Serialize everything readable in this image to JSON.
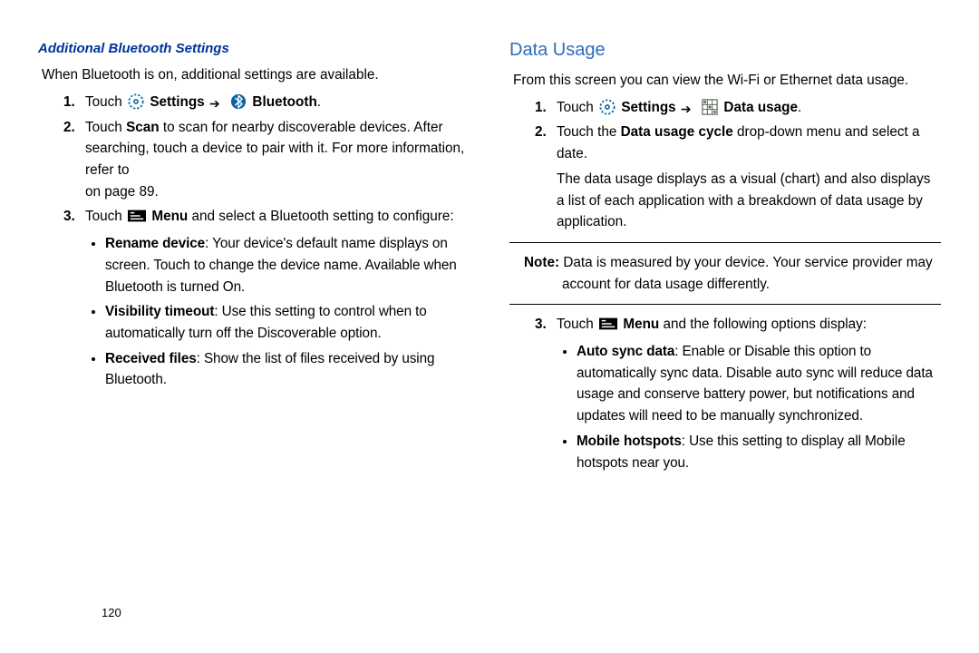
{
  "left": {
    "heading": "Additional Bluetooth Settings",
    "intro": "When Bluetooth is on, additional settings are available.",
    "step1": {
      "n": "1.",
      "pre": "Touch ",
      "settings": " Settings ",
      "bluetooth": " Bluetooth",
      "dot": "."
    },
    "step2": {
      "n": "2.",
      "l1a": "Touch ",
      "l1b": "Scan",
      "l1c": " to scan for nearby discoverable devices. After searching, touch a device to pair with it. For more information, refer to",
      "l2": "on page 89."
    },
    "step3": {
      "n": "3.",
      "pre": "Touch ",
      "menu": " Menu",
      "post": " and select a Bluetooth setting to configure:"
    },
    "bul1": {
      "h": "Rename device",
      "t": ": Your device's default name displays on screen. Touch to change the device name. Available when Bluetooth is turned On."
    },
    "bul2": {
      "h": "Visibility timeout",
      "t": ": Use this setting to control when to automatically turn off the Discoverable option."
    },
    "bul3": {
      "h": "Received files",
      "t": ": Show the list of files received by using Bluetooth."
    }
  },
  "right": {
    "heading": "Data Usage",
    "intro": "From this screen you can view the Wi-Fi or Ethernet data usage.",
    "step1": {
      "n": "1.",
      "pre": "Touch ",
      "settings": " Settings ",
      "datausage": " Data usage",
      "dot": "."
    },
    "step2": {
      "n": "2.",
      "a": "Touch the ",
      "b": "Data usage cycle",
      "c": " drop-down menu and select a date.",
      "d": "The data usage displays as a visual (chart) and also displays a list of each application with a breakdown of data usage by application."
    },
    "note": {
      "label": "Note:",
      "text": " Data is measured by your device. Your service provider may account for data usage differently."
    },
    "step3": {
      "n": "3.",
      "pre": "Touch ",
      "menu": " Menu",
      "post": " and the following options display:"
    },
    "bul1": {
      "h": "Auto sync data",
      "t": ": Enable or Disable this option to automatically sync data. Disable auto sync will reduce data usage and conserve battery power, but notifications and updates will need to be manually synchronized."
    },
    "bul2": {
      "h": "Mobile hotspots",
      "t": ": Use this setting to display all Mobile hotspots near you."
    }
  },
  "pageNumber": "120"
}
